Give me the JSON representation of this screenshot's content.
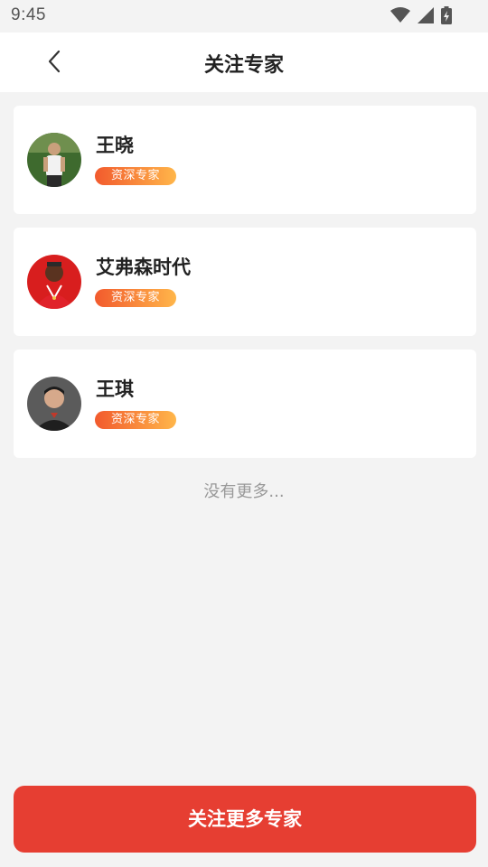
{
  "status_bar": {
    "time": "9:45",
    "icons": [
      "wifi-icon",
      "cellular-signal-icon",
      "battery-charging-icon"
    ]
  },
  "header": {
    "title": "关注专家",
    "back_icon": "chevron-left-icon"
  },
  "experts": [
    {
      "name": "王晓",
      "badge": "资深专家",
      "avatar": "avatar-photo-man-outdoors"
    },
    {
      "name": "艾弗森时代",
      "badge": "资深专家",
      "avatar": "avatar-photo-man-red-jersey"
    },
    {
      "name": "王琪",
      "badge": "资深专家",
      "avatar": "avatar-photo-man-portrait"
    }
  ],
  "list_footer": "没有更多...",
  "follow_more_button": "关注更多专家",
  "colors": {
    "accent": "#e63e32",
    "badge_gradient_start": "#f25a2d",
    "badge_gradient_end": "#ffb64a",
    "background": "#f3f3f3"
  }
}
